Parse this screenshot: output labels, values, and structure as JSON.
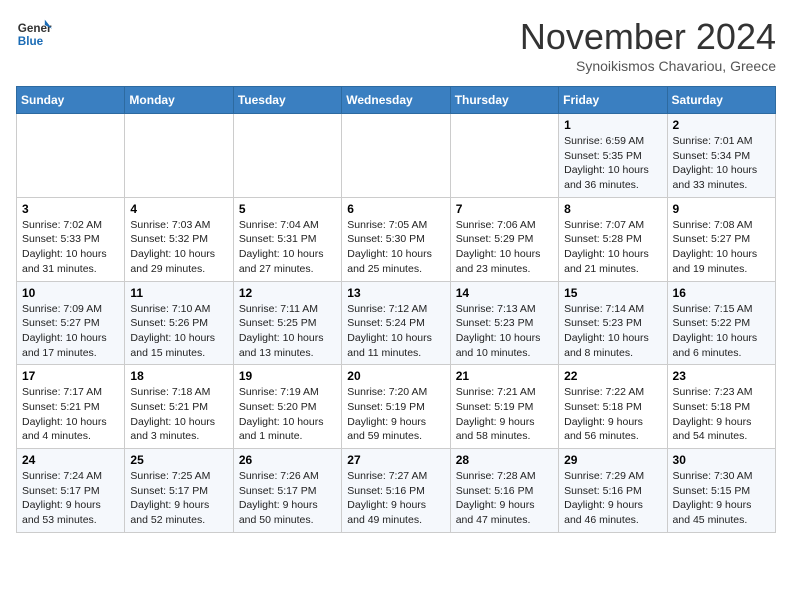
{
  "header": {
    "logo_general": "General",
    "logo_blue": "Blue",
    "month": "November 2024",
    "location": "Synoikismos Chavariou, Greece"
  },
  "weekdays": [
    "Sunday",
    "Monday",
    "Tuesday",
    "Wednesday",
    "Thursday",
    "Friday",
    "Saturday"
  ],
  "weeks": [
    [
      {
        "day": "",
        "info": ""
      },
      {
        "day": "",
        "info": ""
      },
      {
        "day": "",
        "info": ""
      },
      {
        "day": "",
        "info": ""
      },
      {
        "day": "",
        "info": ""
      },
      {
        "day": "1",
        "info": "Sunrise: 6:59 AM\nSunset: 5:35 PM\nDaylight: 10 hours\nand 36 minutes."
      },
      {
        "day": "2",
        "info": "Sunrise: 7:01 AM\nSunset: 5:34 PM\nDaylight: 10 hours\nand 33 minutes."
      }
    ],
    [
      {
        "day": "3",
        "info": "Sunrise: 7:02 AM\nSunset: 5:33 PM\nDaylight: 10 hours\nand 31 minutes."
      },
      {
        "day": "4",
        "info": "Sunrise: 7:03 AM\nSunset: 5:32 PM\nDaylight: 10 hours\nand 29 minutes."
      },
      {
        "day": "5",
        "info": "Sunrise: 7:04 AM\nSunset: 5:31 PM\nDaylight: 10 hours\nand 27 minutes."
      },
      {
        "day": "6",
        "info": "Sunrise: 7:05 AM\nSunset: 5:30 PM\nDaylight: 10 hours\nand 25 minutes."
      },
      {
        "day": "7",
        "info": "Sunrise: 7:06 AM\nSunset: 5:29 PM\nDaylight: 10 hours\nand 23 minutes."
      },
      {
        "day": "8",
        "info": "Sunrise: 7:07 AM\nSunset: 5:28 PM\nDaylight: 10 hours\nand 21 minutes."
      },
      {
        "day": "9",
        "info": "Sunrise: 7:08 AM\nSunset: 5:27 PM\nDaylight: 10 hours\nand 19 minutes."
      }
    ],
    [
      {
        "day": "10",
        "info": "Sunrise: 7:09 AM\nSunset: 5:27 PM\nDaylight: 10 hours\nand 17 minutes."
      },
      {
        "day": "11",
        "info": "Sunrise: 7:10 AM\nSunset: 5:26 PM\nDaylight: 10 hours\nand 15 minutes."
      },
      {
        "day": "12",
        "info": "Sunrise: 7:11 AM\nSunset: 5:25 PM\nDaylight: 10 hours\nand 13 minutes."
      },
      {
        "day": "13",
        "info": "Sunrise: 7:12 AM\nSunset: 5:24 PM\nDaylight: 10 hours\nand 11 minutes."
      },
      {
        "day": "14",
        "info": "Sunrise: 7:13 AM\nSunset: 5:23 PM\nDaylight: 10 hours\nand 10 minutes."
      },
      {
        "day": "15",
        "info": "Sunrise: 7:14 AM\nSunset: 5:23 PM\nDaylight: 10 hours\nand 8 minutes."
      },
      {
        "day": "16",
        "info": "Sunrise: 7:15 AM\nSunset: 5:22 PM\nDaylight: 10 hours\nand 6 minutes."
      }
    ],
    [
      {
        "day": "17",
        "info": "Sunrise: 7:17 AM\nSunset: 5:21 PM\nDaylight: 10 hours\nand 4 minutes."
      },
      {
        "day": "18",
        "info": "Sunrise: 7:18 AM\nSunset: 5:21 PM\nDaylight: 10 hours\nand 3 minutes."
      },
      {
        "day": "19",
        "info": "Sunrise: 7:19 AM\nSunset: 5:20 PM\nDaylight: 10 hours\nand 1 minute."
      },
      {
        "day": "20",
        "info": "Sunrise: 7:20 AM\nSunset: 5:19 PM\nDaylight: 9 hours\nand 59 minutes."
      },
      {
        "day": "21",
        "info": "Sunrise: 7:21 AM\nSunset: 5:19 PM\nDaylight: 9 hours\nand 58 minutes."
      },
      {
        "day": "22",
        "info": "Sunrise: 7:22 AM\nSunset: 5:18 PM\nDaylight: 9 hours\nand 56 minutes."
      },
      {
        "day": "23",
        "info": "Sunrise: 7:23 AM\nSunset: 5:18 PM\nDaylight: 9 hours\nand 54 minutes."
      }
    ],
    [
      {
        "day": "24",
        "info": "Sunrise: 7:24 AM\nSunset: 5:17 PM\nDaylight: 9 hours\nand 53 minutes."
      },
      {
        "day": "25",
        "info": "Sunrise: 7:25 AM\nSunset: 5:17 PM\nDaylight: 9 hours\nand 52 minutes."
      },
      {
        "day": "26",
        "info": "Sunrise: 7:26 AM\nSunset: 5:17 PM\nDaylight: 9 hours\nand 50 minutes."
      },
      {
        "day": "27",
        "info": "Sunrise: 7:27 AM\nSunset: 5:16 PM\nDaylight: 9 hours\nand 49 minutes."
      },
      {
        "day": "28",
        "info": "Sunrise: 7:28 AM\nSunset: 5:16 PM\nDaylight: 9 hours\nand 47 minutes."
      },
      {
        "day": "29",
        "info": "Sunrise: 7:29 AM\nSunset: 5:16 PM\nDaylight: 9 hours\nand 46 minutes."
      },
      {
        "day": "30",
        "info": "Sunrise: 7:30 AM\nSunset: 5:15 PM\nDaylight: 9 hours\nand 45 minutes."
      }
    ]
  ]
}
